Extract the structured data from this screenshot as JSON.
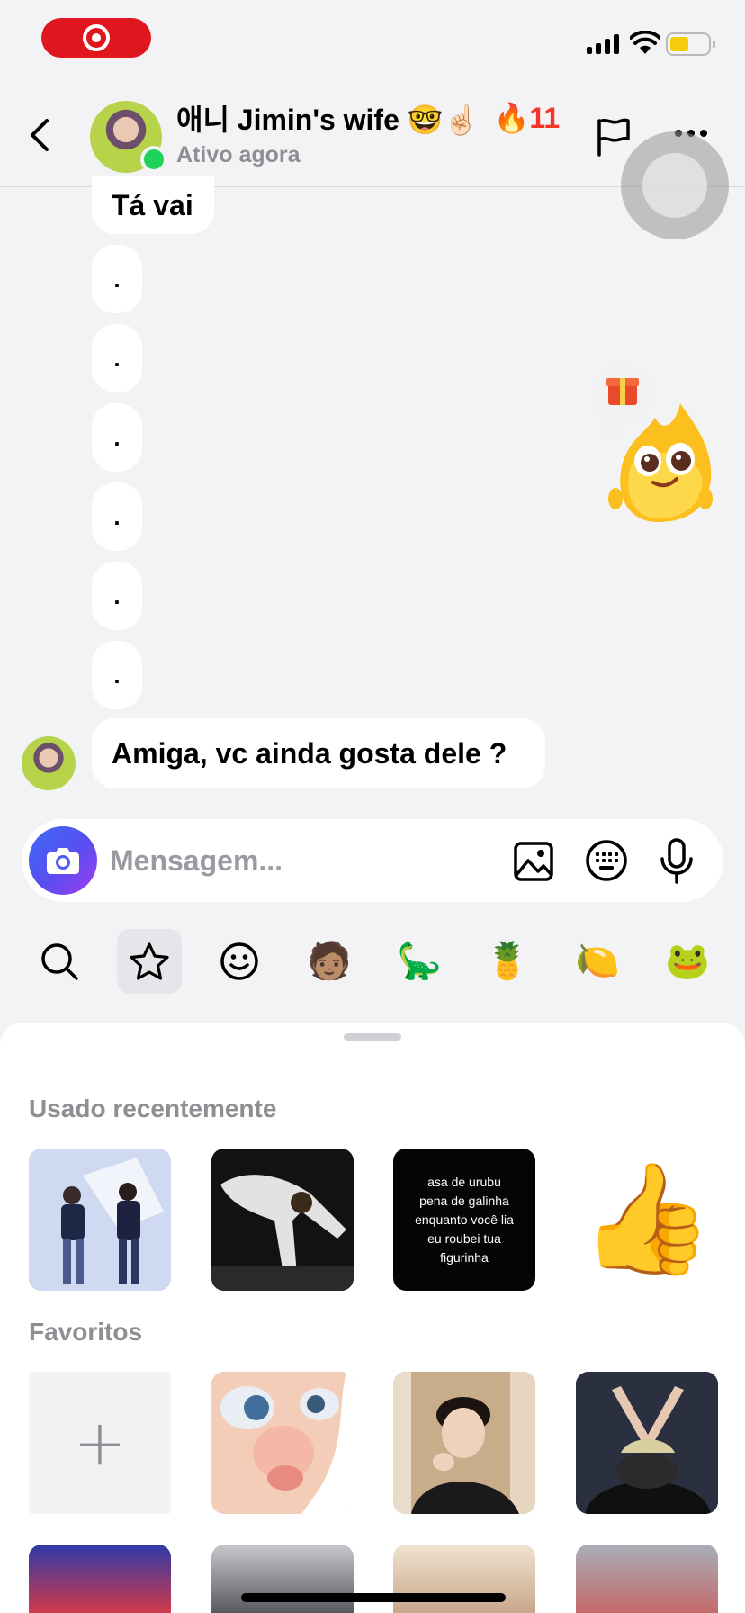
{
  "status_bar": {
    "recording_indicator": "screen-record-icon",
    "battery_color": "#f4cc0c"
  },
  "header": {
    "contact_name": "애니 Jimin's wife 🤓☝🏻",
    "streak": "🔥11",
    "status": "Ativo agora",
    "online_color": "#1fd35a"
  },
  "messages": {
    "top_message": "Tá vai",
    "dots": [
      ".",
      ".",
      ".",
      ".",
      ".",
      "."
    ],
    "last_message": "Amiga, vc ainda gosta dele ?"
  },
  "input": {
    "placeholder": "Mensagem..."
  },
  "sticker_tabs": [
    "search-icon",
    "star-icon",
    "smiley-icon",
    "🧑🏽",
    "🦕",
    "🍍",
    "🍋",
    "🐸"
  ],
  "panel": {
    "recent_title": "Usado recentemente",
    "recent_text_sticker": "asa de urubu\npena de galinha\nenquanto você lia\neu roubei tua figurinha",
    "thumbs_up": "👍",
    "favorites_title": "Favoritos",
    "add_label": "+"
  },
  "colors": {
    "accent_gradient_start": "#3b6bf5",
    "accent_gradient_end": "#a23df2",
    "record_red": "#e0161e"
  }
}
